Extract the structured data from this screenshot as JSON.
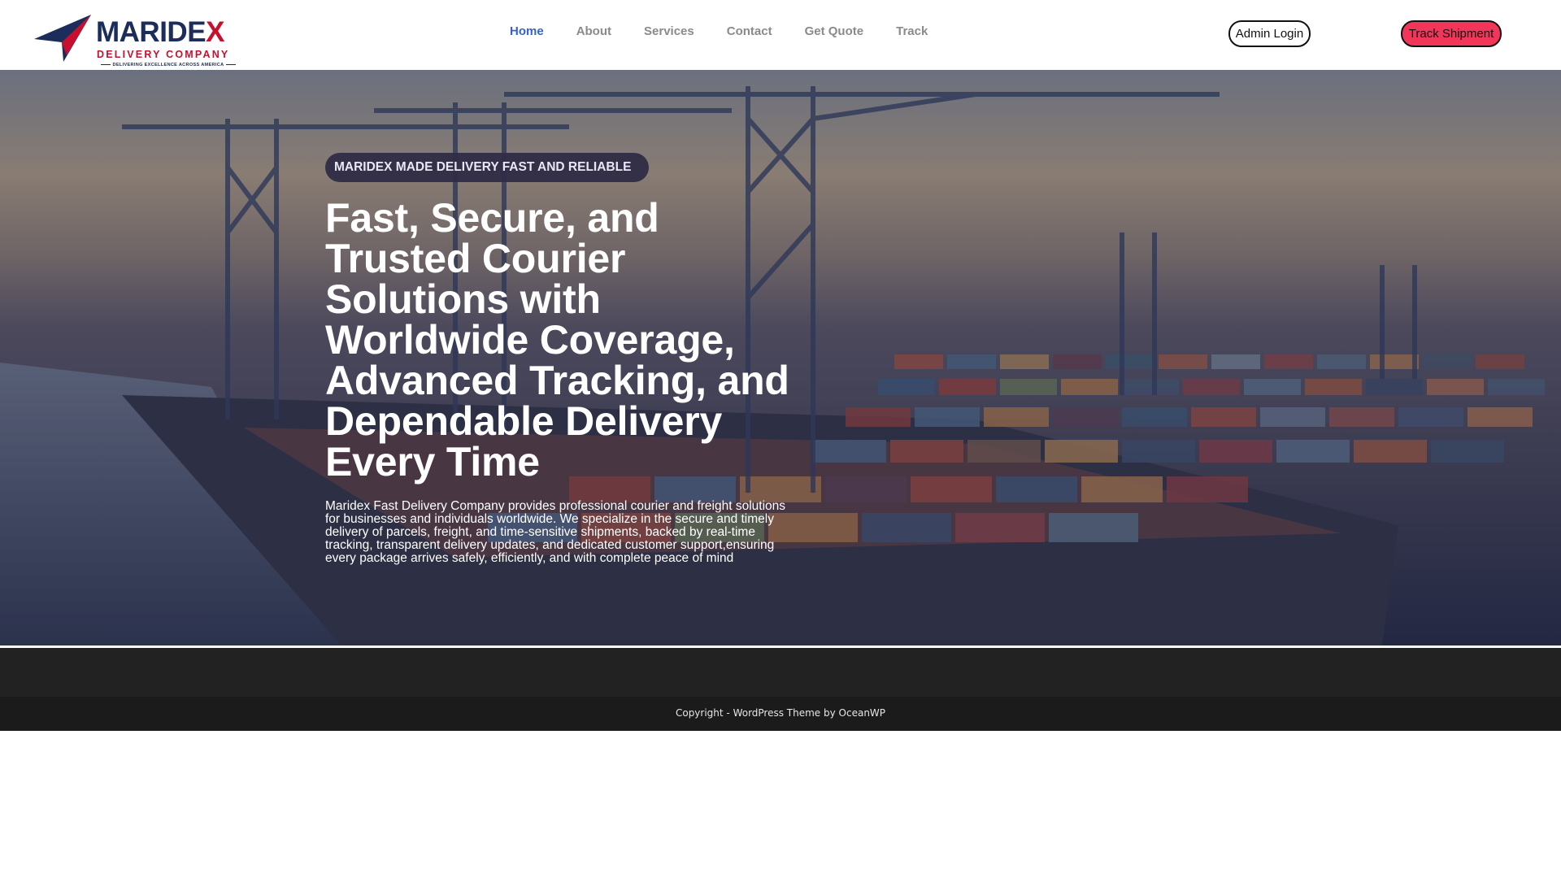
{
  "header": {
    "logo": {
      "name_main": "MARIDE",
      "name_accent": "X",
      "subtitle": "DELIVERY COMPANY",
      "tagline": "DELIVERING EXCELLENCE ACROSS AMERICA"
    },
    "nav": [
      {
        "label": "Home",
        "active": true
      },
      {
        "label": "About",
        "active": false
      },
      {
        "label": "Services",
        "active": false
      },
      {
        "label": "Contact",
        "active": false
      },
      {
        "label": "Get Quote",
        "active": false
      },
      {
        "label": "Track",
        "active": false
      }
    ],
    "admin_login_label": "Admin Login",
    "track_shipment_label": "Track Shipment"
  },
  "hero": {
    "badge": "MARIDEX MADE DELIVERY FAST AND RELIABLE",
    "title_lines": [
      "Fast, Secure, and",
      "Trusted Courier",
      "Solutions with",
      "Worldwide Coverage,",
      "Advanced Tracking, and",
      "Dependable Delivery",
      "Every Time"
    ],
    "description_lines": [
      "Maridex Fast Delivery Company provides professional courier and freight solutions",
      "for businesses and individuals worldwide. We specialize in the secure and timely",
      "delivery of parcels, freight, and time-sensitive shipments, backed by real-time",
      "tracking, transparent delivery updates, and dedicated customer support,ensuring",
      "every package arrives safely, efficiently, and with complete peace of mind"
    ]
  },
  "footer": {
    "copyright": "Copyright - WordPress Theme by OceanWP"
  },
  "colors": {
    "brand_navy": "#1c2d5c",
    "brand_red": "#c8102e",
    "nav_active": "#3862c5",
    "track_button": "#f2365a"
  }
}
